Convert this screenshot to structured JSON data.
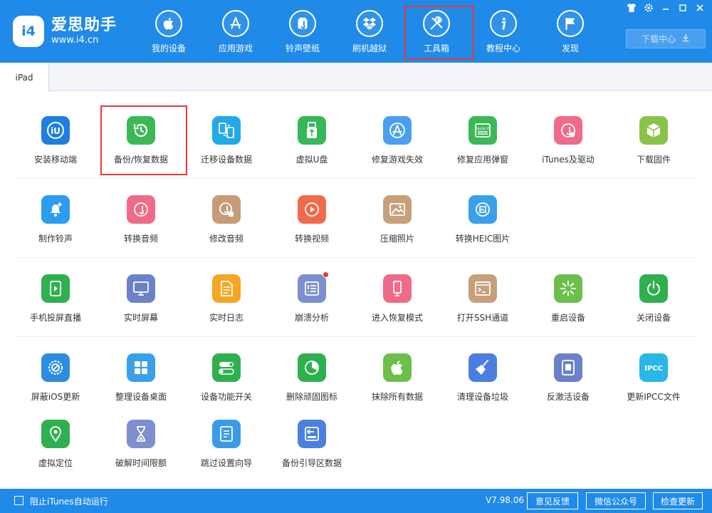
{
  "app": {
    "title": "爱思助手",
    "url": "www.i4.cn",
    "logo_mark": "i4"
  },
  "nav": [
    {
      "label": "我的设备",
      "icon": "apple-icon"
    },
    {
      "label": "应用游戏",
      "icon": "app-store-icon"
    },
    {
      "label": "铃声壁纸",
      "icon": "music-note-icon"
    },
    {
      "label": "刷机越狱",
      "icon": "dropbox-icon"
    },
    {
      "label": "工具箱",
      "icon": "tools-icon",
      "active": true
    },
    {
      "label": "教程中心",
      "icon": "info-icon"
    },
    {
      "label": "发现",
      "icon": "flag-icon"
    }
  ],
  "window_controls": [
    "shirt-icon",
    "gear-icon",
    "minimize-icon",
    "maximize-icon",
    "close-icon"
  ],
  "download_center": {
    "label": "下载中心",
    "icon": "download-icon"
  },
  "tabs": [
    {
      "label": "iPad",
      "active": true
    }
  ],
  "tools": {
    "row1": [
      {
        "label": "安装移动端",
        "icon": "i4-app-icon",
        "color": "#1f7fe0"
      },
      {
        "label": "备份/恢复数据",
        "icon": "backup-restore-icon",
        "color": "#3cb857",
        "highlight": true
      },
      {
        "label": "迁移设备数据",
        "icon": "migrate-icon",
        "color": "#22a9e8"
      },
      {
        "label": "虚拟U盘",
        "icon": "usb-drive-icon",
        "color": "#36b858"
      },
      {
        "label": "修复游戏失效",
        "icon": "app-store-fix-icon",
        "color": "#4a9ff0"
      },
      {
        "label": "修复应用弹窗",
        "icon": "apple-id-icon",
        "color": "#3cb857"
      },
      {
        "label": "iTunes及驱动",
        "icon": "itunes-icon",
        "color": "#f06a8a"
      },
      {
        "label": "下载固件",
        "icon": "cube-icon",
        "color": "#8bc34a"
      }
    ],
    "row2": [
      {
        "label": "制作铃声",
        "icon": "bell-plus-icon",
        "color": "#2c9cf0"
      },
      {
        "label": "转换音频",
        "icon": "music-convert-icon",
        "color": "#f06a8a"
      },
      {
        "label": "修改音频",
        "icon": "music-edit-icon",
        "color": "#c69c78"
      },
      {
        "label": "转换视频",
        "icon": "video-convert-icon",
        "color": "#f26a4c"
      },
      {
        "label": "压缩照片",
        "icon": "photo-icon",
        "color": "#c7a07a"
      },
      {
        "label": "转换HEIC图片",
        "icon": "heic-icon",
        "color": "#3aa0e8"
      }
    ],
    "row3": [
      {
        "label": "手机投屏直播",
        "icon": "screen-cast-icon",
        "color": "#2fb050"
      },
      {
        "label": "实时屏幕",
        "icon": "monitor-icon",
        "color": "#6b82c9"
      },
      {
        "label": "实时日志",
        "icon": "log-icon",
        "color": "#f5a623"
      },
      {
        "label": "崩溃分析",
        "icon": "crash-report-icon",
        "color": "#7d8fcf",
        "badge": true
      },
      {
        "label": "进入恢复模式",
        "icon": "recovery-mode-icon",
        "color": "#f06a8a"
      },
      {
        "label": "打开SSH通道",
        "icon": "terminal-icon",
        "color": "#c7a07a"
      },
      {
        "label": "重启设备",
        "icon": "restart-icon",
        "color": "#6cc04a"
      },
      {
        "label": "关闭设备",
        "icon": "power-icon",
        "color": "#2fb050"
      }
    ],
    "row4": [
      {
        "label": "屏蔽iOS更新",
        "icon": "block-update-icon",
        "color": "#2c8de0"
      },
      {
        "label": "整理设备桌面",
        "icon": "grid-icon",
        "color": "#3aa0e8"
      },
      {
        "label": "设备功能开关",
        "icon": "toggle-icon",
        "color": "#2fb050"
      },
      {
        "label": "删除顽固图标",
        "icon": "pie-icon",
        "color": "#2fb050"
      },
      {
        "label": "抹除所有数据",
        "icon": "erase-apple-icon",
        "color": "#6cc04a"
      },
      {
        "label": "清理设备垃圾",
        "icon": "broom-icon",
        "color": "#4a7fe0"
      },
      {
        "label": "反激活设备",
        "icon": "deactivate-icon",
        "color": "#6b82c9"
      },
      {
        "label": "更新IPCC文件",
        "icon": "ipcc-icon",
        "color": "#29b6e8",
        "icon_text": "IPCC"
      }
    ],
    "row5": [
      {
        "label": "虚拟定位",
        "icon": "location-icon",
        "color": "#2fb050"
      },
      {
        "label": "破解时间限额",
        "icon": "hourglass-icon",
        "color": "#7d8fcf"
      },
      {
        "label": "跳过设置向导",
        "icon": "skip-wizard-icon",
        "color": "#3a9be8"
      },
      {
        "label": "备份引导区数据",
        "icon": "backup-boot-icon",
        "color": "#4a80e0"
      }
    ]
  },
  "footer": {
    "checkbox_label": "阻止iTunes自动运行",
    "version": "V7.98.06",
    "feedback": "意见反馈",
    "wechat": "微信公众号",
    "update": "检查更新"
  }
}
